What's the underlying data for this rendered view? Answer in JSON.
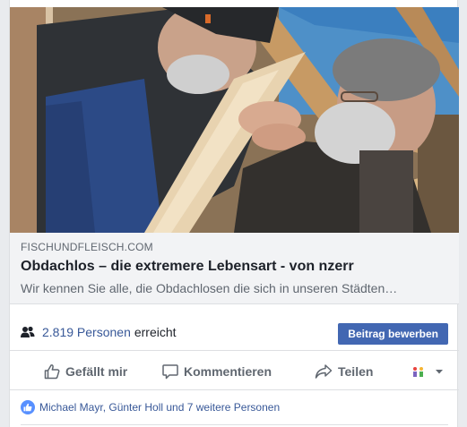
{
  "post": {
    "image_alt": "Two men working with wooden beams",
    "link": {
      "domain": "FISCHUNDFLEISCH.COM",
      "title": "Obdachlos – die extremere Lebensart - von nzerr",
      "description": "Wir kennen Sie alle, die Obdachlosen die sich in unseren Städten…"
    },
    "reach": {
      "icon": "people-icon",
      "count": "2.819 Personen",
      "text": "erreicht",
      "boost_label": "Beitrag bewerben"
    },
    "actions": {
      "like_label": "Gefällt mir",
      "comment_label": "Kommentieren",
      "share_label": "Teilen"
    },
    "likes": {
      "icon": "thumbs-up-icon",
      "text": "Michael Mayr, Günter Holl und 7 weitere Personen"
    }
  },
  "colors": {
    "accent": "#4267b2",
    "link": "#385898",
    "muted": "#606770",
    "like_badge": "#5890ff"
  }
}
